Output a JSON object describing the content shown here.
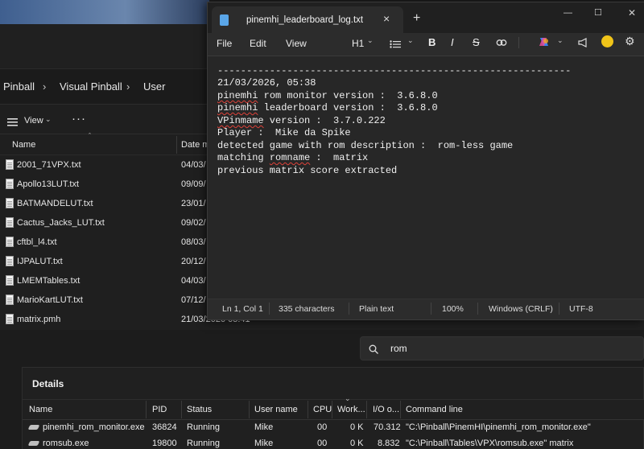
{
  "explorer": {
    "breadcrumb": [
      "Pinball",
      "Visual Pinball",
      "User"
    ],
    "toolbar": {
      "view_label": "View",
      "more_label": "···"
    },
    "columns": {
      "name": "Name",
      "date": "Date m"
    },
    "files": [
      {
        "name": "2001_71VPX.txt",
        "date": "04/03/"
      },
      {
        "name": "Apollo13LUT.txt",
        "date": "09/09/"
      },
      {
        "name": "BATMANDELUT.txt",
        "date": "23/01/"
      },
      {
        "name": "Cactus_Jacks_LUT.txt",
        "date": "09/02/"
      },
      {
        "name": "cftbl_l4.txt",
        "date": "08/03/"
      },
      {
        "name": "IJPALUT.txt",
        "date": "20/12/"
      },
      {
        "name": "LMEMTables.txt",
        "date": "04/03/"
      },
      {
        "name": "MarioKartLUT.txt",
        "date": "07/12/"
      },
      {
        "name": "matrix.pmh",
        "date": "21/03/2026 05:41"
      }
    ]
  },
  "notepad": {
    "tab_title": "pinemhi_leaderboard_log.txt",
    "close_tab": "×",
    "new_tab": "+",
    "window_controls": {
      "minimize": "—",
      "maximize": "☐",
      "close": "✕"
    },
    "menu": {
      "file": "File",
      "edit": "Edit",
      "view": "View"
    },
    "format": {
      "heading": "H1",
      "bold": "B",
      "italic": "I",
      "strike": "S"
    },
    "lines": {
      "l1": "-------------------------------------------------------------",
      "l2": "21/03/2026, 05:38",
      "l3a": "pinemhi",
      "l3b": " rom monitor version :  3.6.8.0",
      "l4a": "pinemhi",
      "l4b": " leaderboard version :  3.6.8.0",
      "l5a": "VPinmame",
      "l5b": " version :  3.7.0.222",
      "l6": "Player :  Mike da Spike",
      "l7": "detected game with rom description :  rom-less game",
      "l8a": "matching ",
      "l8b": "romname",
      "l8c": " :  matrix",
      "l9": "previous matrix score extracted"
    },
    "status": {
      "position": "Ln 1, Col 1",
      "chars": "335 characters",
      "format": "Plain text",
      "zoom": "100%",
      "line_endings": "Windows (CRLF)",
      "encoding": "UTF-8"
    }
  },
  "taskmgr": {
    "search_value": "rom",
    "section_title": "Details",
    "columns": [
      "Name",
      "PID",
      "Status",
      "User name",
      "CPU",
      "Work...",
      "I/O o...",
      "Command line"
    ],
    "rows": [
      {
        "name": "pinemhi_rom_monitor.exe",
        "pid": "36824",
        "status": "Running",
        "user": "Mike",
        "cpu": "00",
        "work": "0 K",
        "io": "70.312",
        "cmd": "\"C:\\Pinball\\PinemHI\\pinemhi_rom_monitor.exe\""
      },
      {
        "name": "romsub.exe",
        "pid": "19800",
        "status": "Running",
        "user": "Mike",
        "cpu": "00",
        "work": "0 K",
        "io": "8.832",
        "cmd": "\"C:\\Pinball\\Tables\\VPX\\romsub.exe\" matrix"
      }
    ]
  }
}
